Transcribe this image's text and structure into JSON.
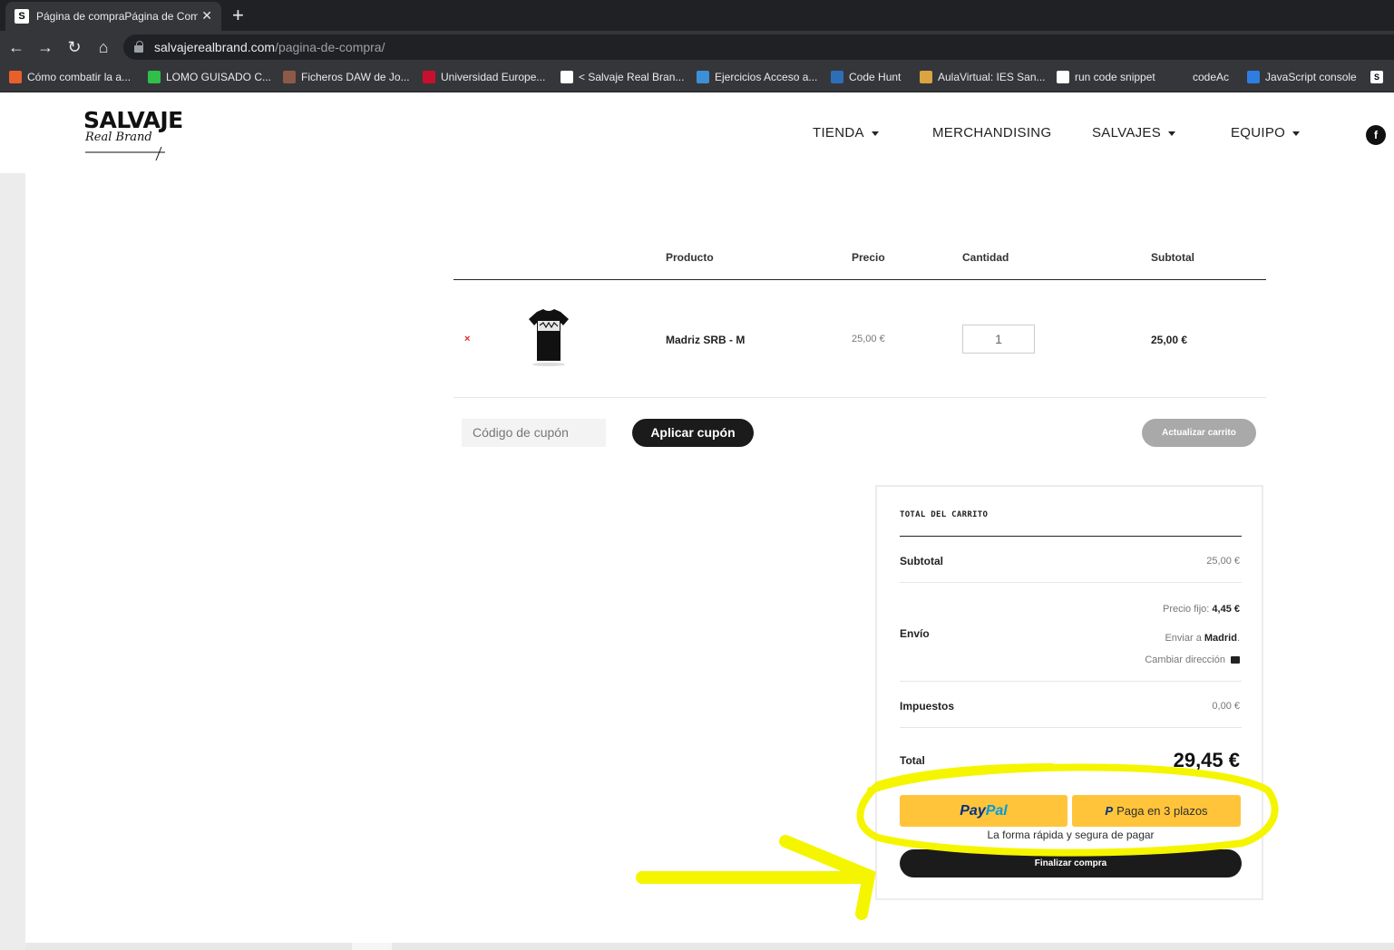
{
  "browser": {
    "tab_title": "Página de compraPágina de Com",
    "url_host": "salvajerealbrand.com",
    "url_path": "/pagina-de-compra/"
  },
  "bookmarks": [
    {
      "label": "Cómo combatir la a...",
      "color": "#e8612c"
    },
    {
      "label": "LOMO GUISADO C...",
      "color": "#2fbf4a"
    },
    {
      "label": "Ficheros DAW de Jo...",
      "color": "#8d5a4a"
    },
    {
      "label": "Universidad Europe...",
      "color": "#c8102e"
    },
    {
      "label": "< Salvaje Real Bran...",
      "color": "#ffffff"
    },
    {
      "label": "Ejercicios Acceso a...",
      "color": "#3d8fd6"
    },
    {
      "label": "Code Hunt",
      "color": "#2d6fb7"
    },
    {
      "label": "AulaVirtual: IES San...",
      "color": "#d9a441"
    },
    {
      "label": "run code snippet",
      "color": "#ffffff"
    },
    {
      "label": "codeAc",
      "color": "#35363a"
    },
    {
      "label": "JavaScript console",
      "color": "#2f7de1"
    }
  ],
  "site": {
    "logo_line1": "SALVAJE",
    "logo_line2": "Real Brand",
    "nav": [
      "TIENDA",
      "MERCHANDISING",
      "SALVAJES",
      "EQUIPO"
    ]
  },
  "cart": {
    "headers": {
      "product": "Producto",
      "price": "Precio",
      "quantity": "Cantidad",
      "subtotal": "Subtotal"
    },
    "item": {
      "remove": "×",
      "name": "Madriz SRB - M",
      "price": "25,00 €",
      "quantity": "1",
      "subtotal": "25,00 €"
    },
    "coupon_placeholder": "Código de cupón",
    "apply_coupon": "Aplicar cupón",
    "update_cart": "Actualizar carrito"
  },
  "totals": {
    "title": "TOTAL DEL CARRITO",
    "subtotal_label": "Subtotal",
    "subtotal_value": "25,00 €",
    "shipping_label": "Envío",
    "shipping_rate_prefix": "Precio fijo: ",
    "shipping_rate": "4,45 €",
    "ship_to_prefix": "Enviar a ",
    "ship_to": "Madrid",
    "ship_to_suffix": ".",
    "change_address": "Cambiar dirección",
    "tax_label": "Impuestos",
    "tax_value": "0,00 €",
    "total_label": "Total",
    "total_value": "29,45 €",
    "paypal_a": "Pay",
    "paypal_b": "Pal",
    "plazos_label": "Paga en 3 plazos",
    "paypal_tagline": "La forma rápida y segura de pagar",
    "finalize": "Finalizar compra"
  },
  "annotation_color": "#f5f500"
}
